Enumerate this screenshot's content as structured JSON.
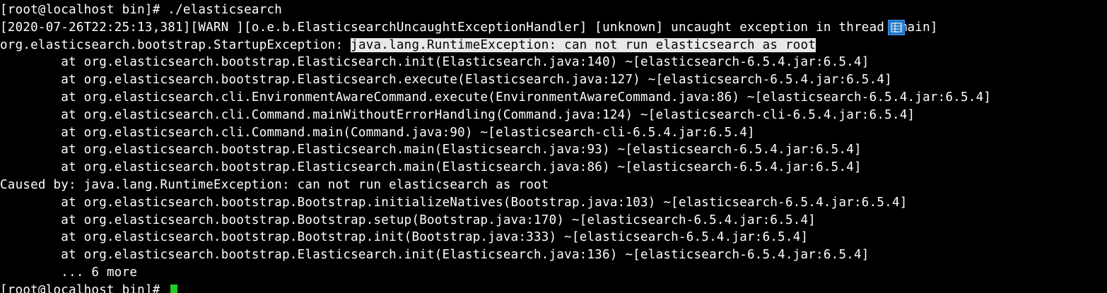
{
  "terminal": {
    "lines": [
      {
        "text": "[root@localhost bin]# ./elasticsearch"
      },
      {
        "text": "[2020-07-26T22:25:13,381][WARN ][o.e.b.ElasticsearchUncaughtExceptionHandler] [unknown] uncaught exception in thread [main]"
      },
      {
        "prefix": "org.elasticsearch.bootstrap.StartupException: ",
        "selected": "java.lang.RuntimeException: can not run elasticsearch as root"
      },
      {
        "text": "        at org.elasticsearch.bootstrap.Elasticsearch.init(Elasticsearch.java:140) ~[elasticsearch-6.5.4.jar:6.5.4]"
      },
      {
        "text": "        at org.elasticsearch.bootstrap.Elasticsearch.execute(Elasticsearch.java:127) ~[elasticsearch-6.5.4.jar:6.5.4]"
      },
      {
        "text": "        at org.elasticsearch.cli.EnvironmentAwareCommand.execute(EnvironmentAwareCommand.java:86) ~[elasticsearch-6.5.4.jar:6.5.4]"
      },
      {
        "text": "        at org.elasticsearch.cli.Command.mainWithoutErrorHandling(Command.java:124) ~[elasticsearch-cli-6.5.4.jar:6.5.4]"
      },
      {
        "text": "        at org.elasticsearch.cli.Command.main(Command.java:90) ~[elasticsearch-cli-6.5.4.jar:6.5.4]"
      },
      {
        "text": "        at org.elasticsearch.bootstrap.Elasticsearch.main(Elasticsearch.java:93) ~[elasticsearch-6.5.4.jar:6.5.4]"
      },
      {
        "text": "        at org.elasticsearch.bootstrap.Elasticsearch.main(Elasticsearch.java:86) ~[elasticsearch-6.5.4.jar:6.5.4]"
      },
      {
        "text": "Caused by: java.lang.RuntimeException: can not run elasticsearch as root"
      },
      {
        "text": "        at org.elasticsearch.bootstrap.Bootstrap.initializeNatives(Bootstrap.java:103) ~[elasticsearch-6.5.4.jar:6.5.4]"
      },
      {
        "text": "        at org.elasticsearch.bootstrap.Bootstrap.setup(Bootstrap.java:170) ~[elasticsearch-6.5.4.jar:6.5.4]"
      },
      {
        "text": "        at org.elasticsearch.bootstrap.Bootstrap.init(Bootstrap.java:333) ~[elasticsearch-6.5.4.jar:6.5.4]"
      },
      {
        "text": "        at org.elasticsearch.bootstrap.Elasticsearch.init(Elasticsearch.java:136) ~[elasticsearch-6.5.4.jar:6.5.4]"
      },
      {
        "text": "        ... 6 more"
      },
      {
        "text": "[root@localhost bin]# "
      }
    ]
  },
  "overlay": {
    "icon": "table-icon",
    "color": "#1f7fd6"
  },
  "colors": {
    "background": "#000000",
    "foreground": "#ffffff",
    "selection_bg": "#e8e8e8",
    "selection_fg": "#000000",
    "cursor": "#22cc22"
  }
}
